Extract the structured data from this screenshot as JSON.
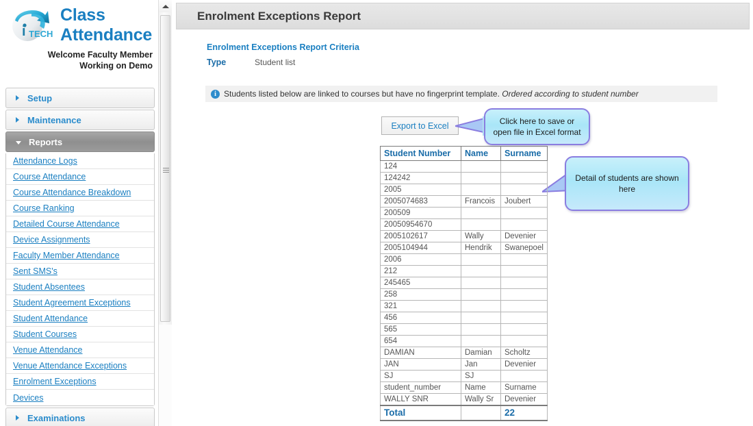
{
  "brand": {
    "title_line1": "Class",
    "title_line2": "Attendance",
    "welcome_line1_prefix": "Welcome ",
    "welcome_line1": "Welcome Faculty Member",
    "welcome_line2": "Working on Demo",
    "logo_text": "iP TECH",
    "accent_color": "#1a7fc1"
  },
  "sidebar": {
    "groups": [
      {
        "label": "Setup",
        "expanded": false
      },
      {
        "label": "Maintenance",
        "expanded": false
      },
      {
        "label": "Reports",
        "expanded": true
      }
    ],
    "reports_items": [
      {
        "label": "Attendance Logs"
      },
      {
        "label": "Course Attendance"
      },
      {
        "label": "Course Attendance Breakdown"
      },
      {
        "label": "Course Ranking"
      },
      {
        "label": "Detailed Course Attendance"
      },
      {
        "label": "Device Assignments"
      },
      {
        "label": "Faculty Member Attendance"
      },
      {
        "label": "Sent SMS's"
      },
      {
        "label": "Student Absentees"
      },
      {
        "label": "Student Agreement Exceptions"
      },
      {
        "label": "Student Attendance"
      },
      {
        "label": "Student Courses"
      },
      {
        "label": "Venue Attendance"
      },
      {
        "label": "Venue Attendance Exceptions"
      },
      {
        "label": "Enrolment Exceptions"
      },
      {
        "label": "Devices"
      }
    ],
    "bottom_group": {
      "label": "Examinations",
      "expanded": false
    }
  },
  "header": {
    "title": "Enrolment Exceptions Report"
  },
  "criteria": {
    "title": "Enrolment Exceptions Report Criteria",
    "type_label": "Type",
    "type_value": "Student list"
  },
  "info": {
    "icon": "info-circle-icon",
    "text_plain": "Students listed below are linked to courses but have no fingerprint template. Ordered according to student number",
    "text_main": "Students listed below are linked to courses but have no fingerprint template.",
    "text_italic": "Ordered according to student number"
  },
  "toolbar": {
    "export_label": "Export to Excel"
  },
  "callouts": [
    {
      "text": "Click here to save or open file in Excel format",
      "target": "export-to-excel-button"
    },
    {
      "text": "Detail of students are shown here",
      "target": "report-table"
    }
  ],
  "table": {
    "columns": [
      "Student Number",
      "Name",
      "Surname"
    ],
    "rows": [
      [
        "124",
        "",
        ""
      ],
      [
        "124242",
        "",
        ""
      ],
      [
        "2005",
        "",
        ""
      ],
      [
        "2005074683",
        "Francois",
        "Joubert"
      ],
      [
        "200509",
        "",
        ""
      ],
      [
        "20050954670",
        "",
        ""
      ],
      [
        "2005102617",
        "Wally",
        "Devenier"
      ],
      [
        "2005104944",
        "Hendrik",
        "Swanepoel"
      ],
      [
        "2006",
        "",
        ""
      ],
      [
        "212",
        "",
        ""
      ],
      [
        "245465",
        "",
        ""
      ],
      [
        "258",
        "",
        ""
      ],
      [
        "321",
        "",
        ""
      ],
      [
        "456",
        "",
        ""
      ],
      [
        "565",
        "",
        ""
      ],
      [
        "654",
        "",
        ""
      ],
      [
        "DAMIAN",
        "Damian",
        "Scholtz"
      ],
      [
        "JAN",
        "Jan",
        "Devenier"
      ],
      [
        "SJ",
        "SJ",
        ""
      ],
      [
        "student_number",
        "Name",
        "Surname"
      ],
      [
        "WALLY SNR",
        "Wally Sr",
        "Devenier"
      ]
    ],
    "total_label": "Total",
    "total_value": "22"
  }
}
